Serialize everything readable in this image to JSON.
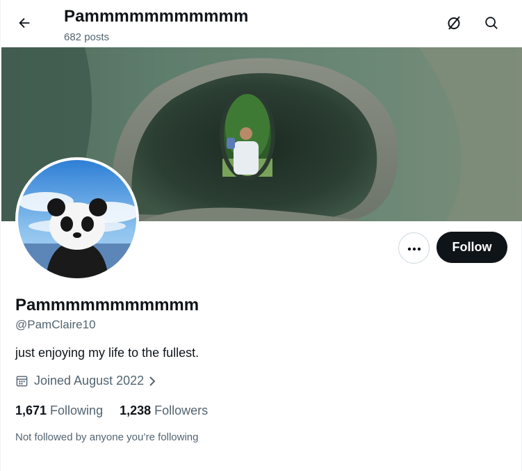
{
  "header": {
    "title": "Pammmmmmmmmmm",
    "posts_count": "682 posts"
  },
  "icons": {
    "back": "arrow-left-icon",
    "grok": "grok-icon",
    "search": "search-icon",
    "more": "more-dots-icon",
    "calendar": "calendar-icon",
    "chevron": "chevron-right-icon"
  },
  "profile": {
    "display_name": "Pammmmmmmmmmm",
    "handle": "@PamClaire10",
    "bio": "just enjoying my life to the fullest.",
    "joined": "Joined August 2022",
    "following_count": "1,671",
    "following_label": "Following",
    "followers_count": "1,238",
    "followers_label": "Followers",
    "not_followed": "Not followed by anyone you’re following"
  },
  "actions": {
    "follow_label": "Follow"
  },
  "colors": {
    "text_primary": "#0f1419",
    "text_secondary": "#536471",
    "follow_bg": "#0f1419",
    "border": "#cfd9de"
  }
}
